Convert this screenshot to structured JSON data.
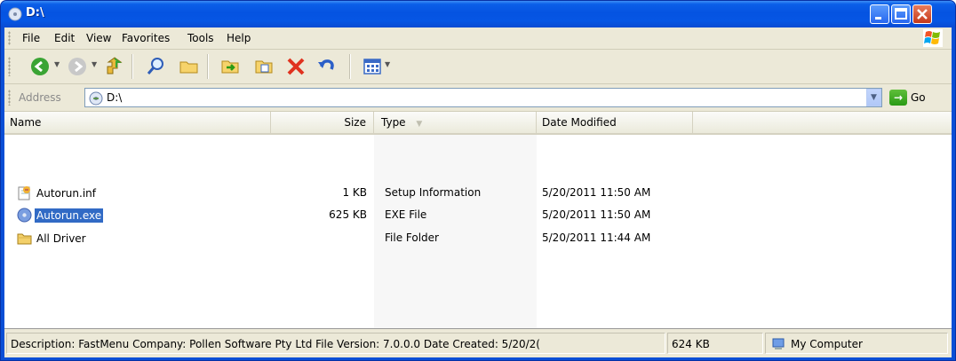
{
  "window": {
    "title": "D:\\"
  },
  "menu": [
    "File",
    "Edit",
    "View",
    "Favorites",
    "Tools",
    "Help"
  ],
  "toolbar": {
    "buttons": [
      "back-icon",
      "forward-icon",
      "up-icon",
      "search-icon",
      "folders-icon",
      "move-to-icon",
      "copy-to-icon",
      "delete-icon",
      "undo-icon",
      "views-icon"
    ]
  },
  "address": {
    "label": "Address",
    "value": "D:\\",
    "go_label": "Go"
  },
  "columns": {
    "name": "Name",
    "size": "Size",
    "type": "Type",
    "date": "Date Modified"
  },
  "files": [
    {
      "name": "Autorun.inf",
      "size": "1 KB",
      "type": "Setup Information",
      "date": "5/20/2011 11:50 AM",
      "icon": "setup-info-icon"
    },
    {
      "name": "Autorun.exe",
      "size": "625 KB",
      "type": "EXE File",
      "date": "5/20/2011 11:50 AM",
      "icon": "exe-icon"
    },
    {
      "name": "All Driver",
      "size": "",
      "type": "File Folder",
      "date": "5/20/2011 11:44 AM",
      "icon": "folder-icon"
    }
  ],
  "status": {
    "description": "Description: FastMenu Company: Pollen Software Pty Ltd File Version: 7.0.0.0 Date Created: 5/20/2(",
    "size": "624 KB",
    "zone": "My Computer"
  },
  "colors": {
    "titlebar": "#0553e1",
    "selection": "#316ac5",
    "chrome": "#ece9d8"
  }
}
